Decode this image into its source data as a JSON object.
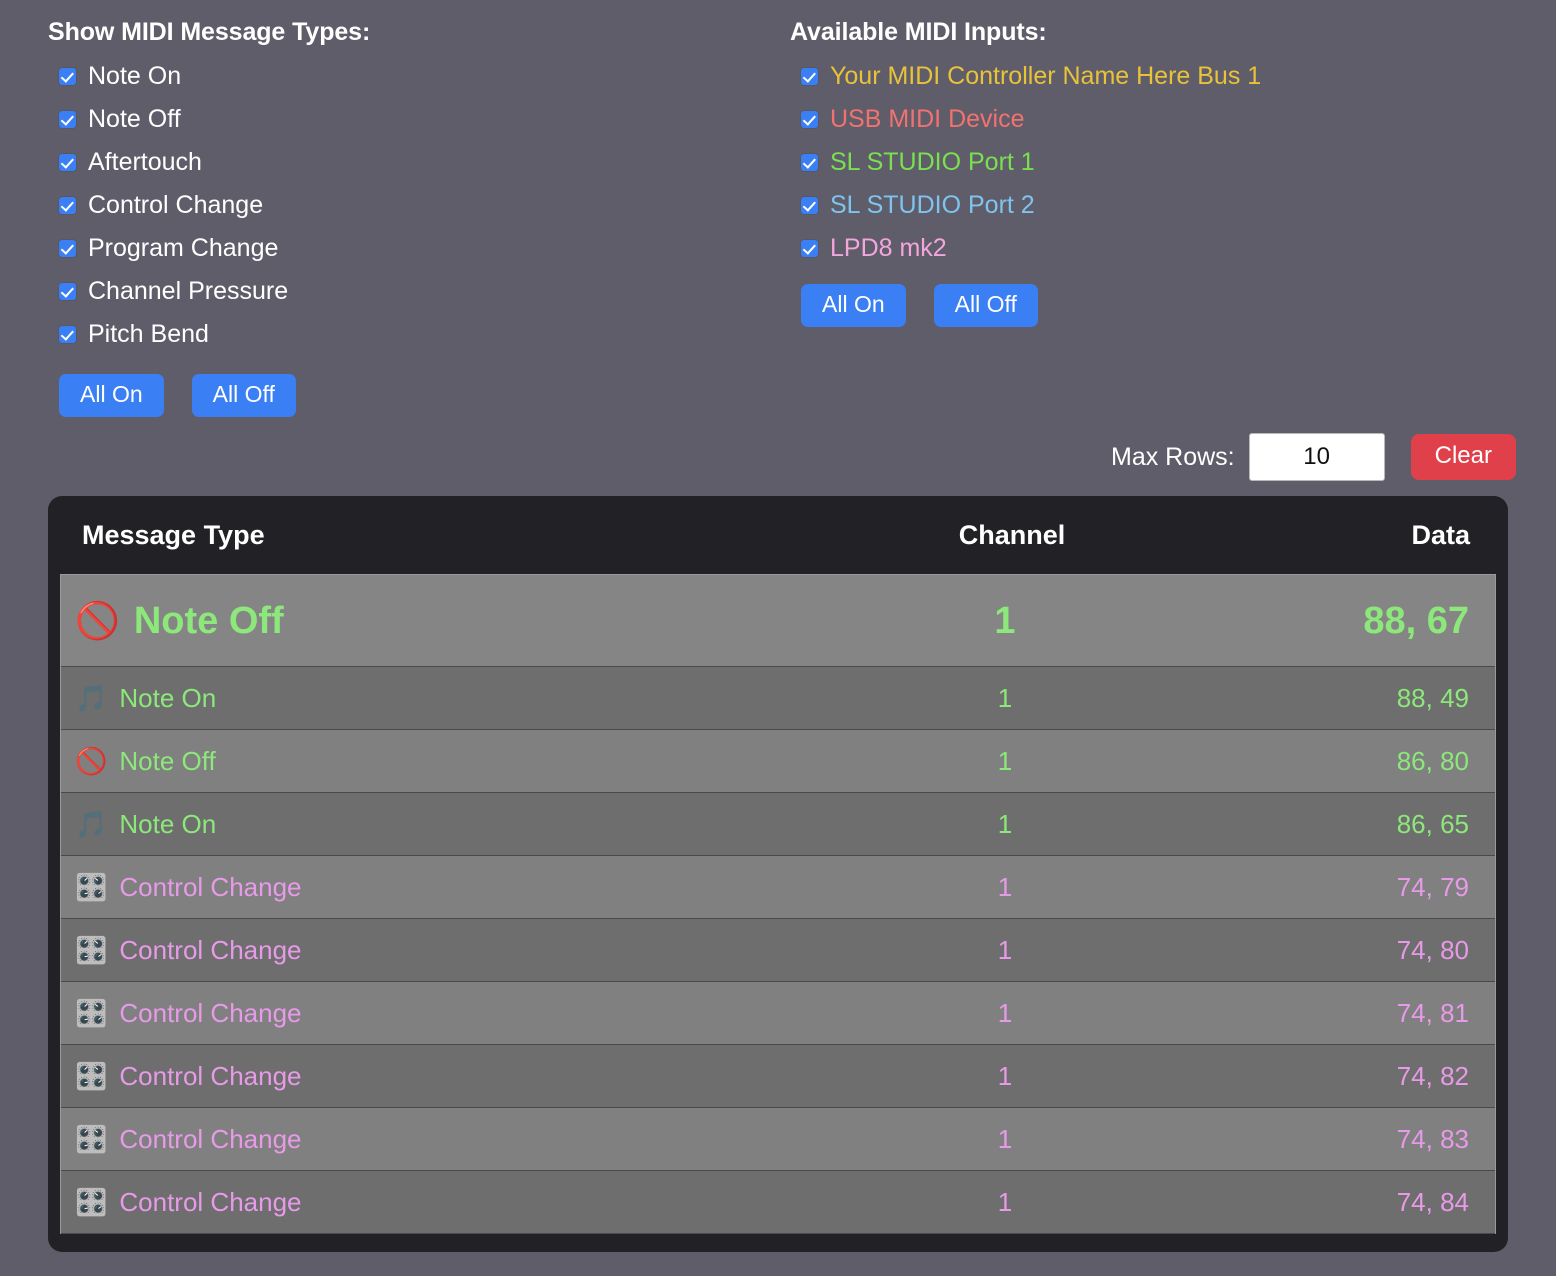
{
  "message_types": {
    "title": "Show MIDI Message Types:",
    "items": [
      {
        "label": "Note On",
        "checked": true
      },
      {
        "label": "Note Off",
        "checked": true
      },
      {
        "label": "Aftertouch",
        "checked": true
      },
      {
        "label": "Control Change",
        "checked": true
      },
      {
        "label": "Program Change",
        "checked": true
      },
      {
        "label": "Channel Pressure",
        "checked": true
      },
      {
        "label": "Pitch Bend",
        "checked": true
      }
    ],
    "all_on_label": "All On",
    "all_off_label": "All Off"
  },
  "midi_inputs": {
    "title": "Available MIDI Inputs:",
    "items": [
      {
        "label": "Your MIDI Controller Name Here Bus 1",
        "color": "#e8c33a",
        "checked": true
      },
      {
        "label": "USB MIDI Device",
        "color": "#f2726f",
        "checked": true
      },
      {
        "label": "SL STUDIO Port 1",
        "color": "#7ae04f",
        "checked": true
      },
      {
        "label": "SL STUDIO Port 2",
        "color": "#7fc4ee",
        "checked": true
      },
      {
        "label": "LPD8 mk2",
        "color": "#f3a6dd",
        "checked": true
      }
    ],
    "all_on_label": "All On",
    "all_off_label": "All Off"
  },
  "toolbar": {
    "max_rows_label": "Max Rows:",
    "max_rows_value": "10",
    "max_rows_placeholder": "10",
    "clear_label": "Clear"
  },
  "monitor": {
    "columns": {
      "type": "Message Type",
      "channel": "Channel",
      "data": "Data"
    },
    "rows": [
      {
        "icon": "🚫",
        "icon_name": "prohibited-icon",
        "type": "Note Off",
        "channel": "1",
        "data": "88, 67",
        "color": "#8ce87a",
        "highlight": true
      },
      {
        "icon": "🎵",
        "icon_name": "musical-note-icon",
        "type": "Note On",
        "channel": "1",
        "data": "88, 49",
        "color": "#8ce87a",
        "highlight": false
      },
      {
        "icon": "🚫",
        "icon_name": "prohibited-icon",
        "type": "Note Off",
        "channel": "1",
        "data": "86, 80",
        "color": "#8ce87a",
        "highlight": false
      },
      {
        "icon": "🎵",
        "icon_name": "musical-note-icon",
        "type": "Note On",
        "channel": "1",
        "data": "86, 65",
        "color": "#8ce87a",
        "highlight": false
      },
      {
        "icon": "🎛️",
        "icon_name": "control-knobs-icon",
        "type": "Control Change",
        "channel": "1",
        "data": "74, 79",
        "color": "#e79ae8",
        "highlight": false
      },
      {
        "icon": "🎛️",
        "icon_name": "control-knobs-icon",
        "type": "Control Change",
        "channel": "1",
        "data": "74, 80",
        "color": "#e79ae8",
        "highlight": false
      },
      {
        "icon": "🎛️",
        "icon_name": "control-knobs-icon",
        "type": "Control Change",
        "channel": "1",
        "data": "74, 81",
        "color": "#e79ae8",
        "highlight": false
      },
      {
        "icon": "🎛️",
        "icon_name": "control-knobs-icon",
        "type": "Control Change",
        "channel": "1",
        "data": "74, 82",
        "color": "#e79ae8",
        "highlight": false
      },
      {
        "icon": "🎛️",
        "icon_name": "control-knobs-icon",
        "type": "Control Change",
        "channel": "1",
        "data": "74, 83",
        "color": "#e79ae8",
        "highlight": false
      },
      {
        "icon": "🎛️",
        "icon_name": "control-knobs-icon",
        "type": "Control Change",
        "channel": "1",
        "data": "74, 84",
        "color": "#e79ae8",
        "highlight": false
      }
    ]
  },
  "theme": {
    "page_background": "#5f5d69",
    "panel_background": "#222226",
    "accent_blue": "#3b7ff5",
    "accent_red": "#e0404a",
    "row_light": "#808080",
    "row_dark": "#6e6e6e"
  }
}
